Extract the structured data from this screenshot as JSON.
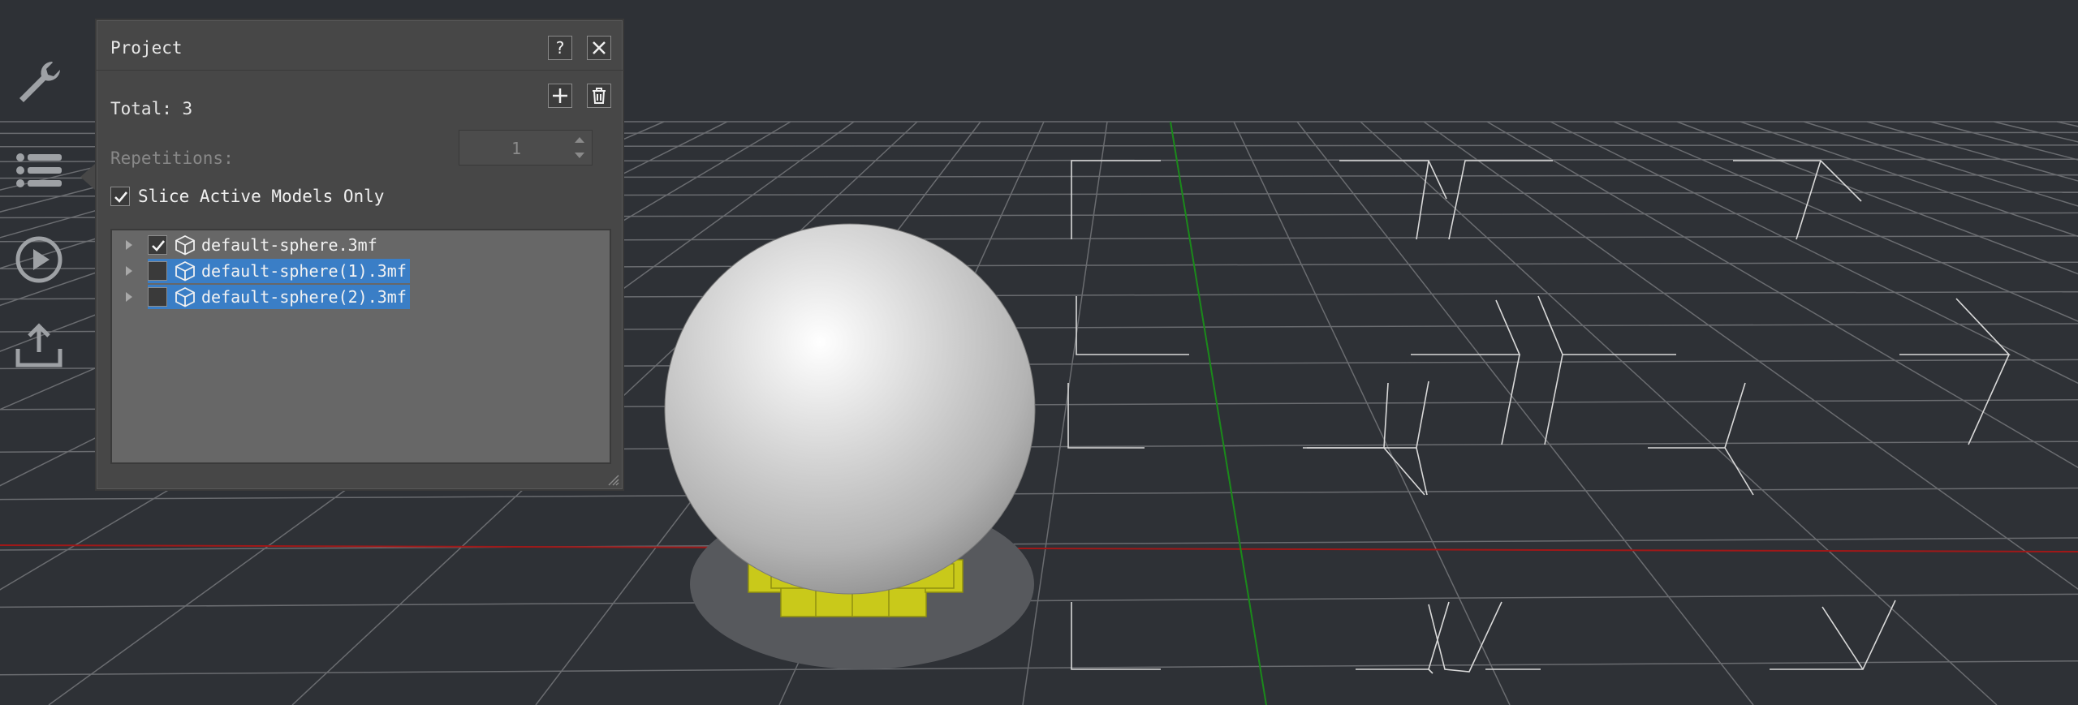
{
  "toolbar": {
    "items": [
      {
        "name": "wrench-icon"
      },
      {
        "name": "list-icon"
      },
      {
        "name": "play-icon"
      },
      {
        "name": "upload-icon"
      }
    ]
  },
  "panel": {
    "title": "Project",
    "help_label": "?",
    "total_label": "Total: 3",
    "repetitions_label": "Repetitions:",
    "repetitions_value": "1",
    "slice_active_label": "Slice Active Models Only",
    "slice_active_checked": true
  },
  "models": [
    {
      "name": "default-sphere.3mf",
      "checked": true,
      "selected": false
    },
    {
      "name": "default-sphere(1).3mf",
      "checked": false,
      "selected": true
    },
    {
      "name": "default-sphere(2).3mf",
      "checked": false,
      "selected": true
    }
  ],
  "colors": {
    "background": "#2e3136",
    "panel": "#474747",
    "selection": "#3a7ec6",
    "support": "#c9c91a",
    "x_axis": "#a01818",
    "y_axis": "#1a8a1a"
  }
}
